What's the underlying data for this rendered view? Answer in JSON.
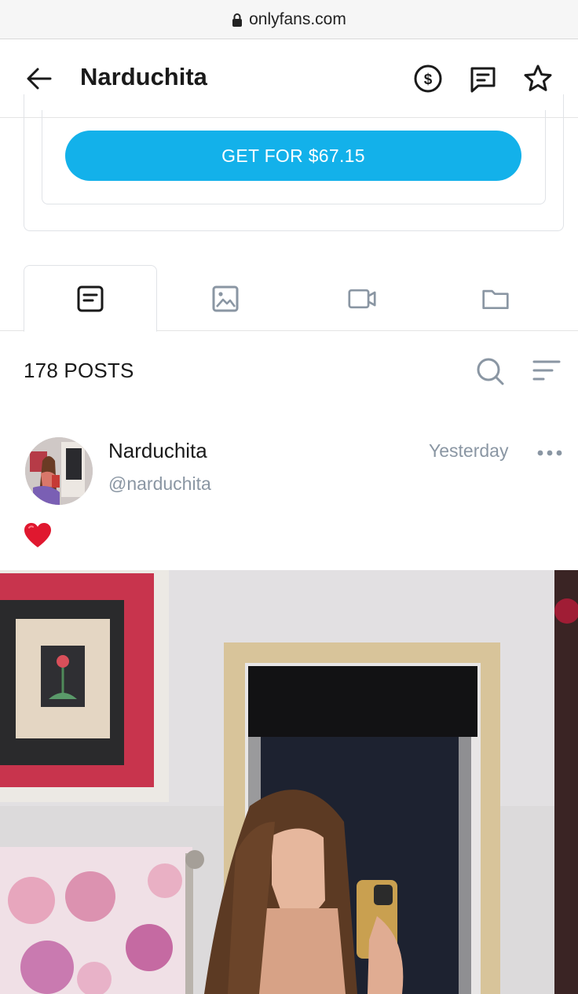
{
  "browser": {
    "url": "onlyfans.com"
  },
  "header": {
    "title": "Narduchita"
  },
  "bundle": {
    "buy_label": "GET FOR $67.15"
  },
  "posts": {
    "count_label": "178 POSTS"
  },
  "post": {
    "author_name": "Narduchita",
    "author_handle": "@narduchita",
    "time": "Yesterday",
    "text": "❤️"
  },
  "colors": {
    "accent": "#13b1ea",
    "muted": "#8a96a3",
    "icon_gray": "#8a96a3"
  }
}
